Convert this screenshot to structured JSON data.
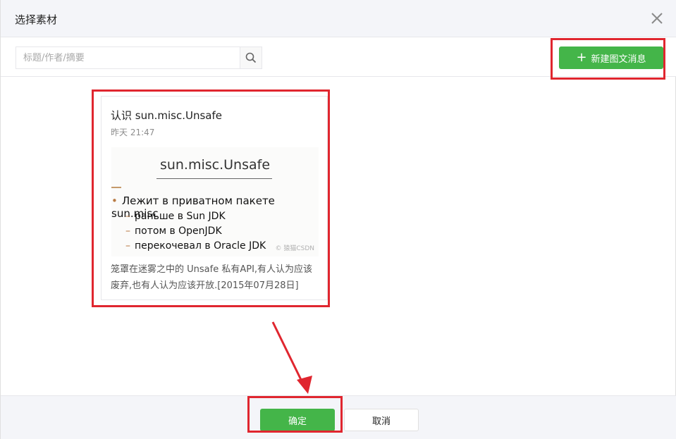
{
  "dialog": {
    "title": "选择素材",
    "close_icon": "close-icon"
  },
  "toolbar": {
    "search_placeholder": "标题/作者/摘要",
    "search_value": "",
    "search_icon": "search-icon",
    "new_button_label": "新建图文消息",
    "new_button_icon": "plus-icon"
  },
  "articles": [
    {
      "title": "认识 sun.misc.Unsafe",
      "time": "昨天 21:47",
      "cover": {
        "heading": "sun.misc.Unsafe",
        "bullet": "Лежит в приватном пакете sun.misc",
        "sub_items": [
          "раньше в Sun JDK",
          "потом в OpenJDK",
          "перекочевал в Oracle JDK"
        ],
        "watermark": "© 猿猫CSDN"
      },
      "digest": "笼罩在迷雾之中的 Unsafe 私有API,有人认为应该废弃,也有人认为应该开放.[2015年07月28日]"
    }
  ],
  "footer": {
    "ok_label": "确定",
    "cancel_label": "取消"
  },
  "colors": {
    "primary_green": "#44b549",
    "highlight_red": "#e0262f",
    "header_bg": "#f4f5f9"
  }
}
